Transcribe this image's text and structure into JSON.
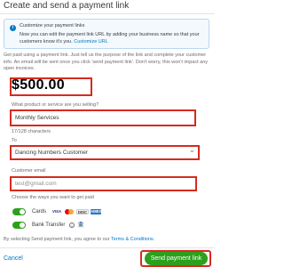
{
  "header": {
    "title": "Create and send a payment link"
  },
  "info_card": {
    "icon": "info-icon",
    "title": "Customize your payment links",
    "body": "Now you can edit the payment link URL by adding your business name so that your customers know it's you.",
    "link_text": "Customize URL"
  },
  "description": "Get paid using a payment link. Just tell us the purpose of the link and complete your customer info. An email will be sent once you click 'send payment link'. Don't worry, this won't impact any open invoices.",
  "amount": "$500.00",
  "purpose": {
    "label": "What product or service are you selling?",
    "value": "Monthly Services",
    "char_count": "17/128 characters"
  },
  "recipient": {
    "label": "To",
    "selected": "Dancing Numbers Customer",
    "icon": "chevron-down-icon"
  },
  "email": {
    "label": "Customer email",
    "placeholder": "test@gmail.com"
  },
  "payment_methods": {
    "label": "Choose the ways you want to get paid",
    "cards": {
      "label": "Cards",
      "enabled": true,
      "brands": [
        "VISA",
        "MC",
        "DISC",
        "AMEX"
      ]
    },
    "bank": {
      "label": "Bank Transfer",
      "enabled": true
    }
  },
  "terms": {
    "prefix": "By selecting Send payment link, you agree to our",
    "link": "Terms & Conditions",
    "suffix": "."
  },
  "footer": {
    "cancel_label": "Cancel",
    "send_label": "Send payment link"
  },
  "colors": {
    "accent": "#2ca01c",
    "link": "#0077c5",
    "highlight": "#d52b1e"
  }
}
